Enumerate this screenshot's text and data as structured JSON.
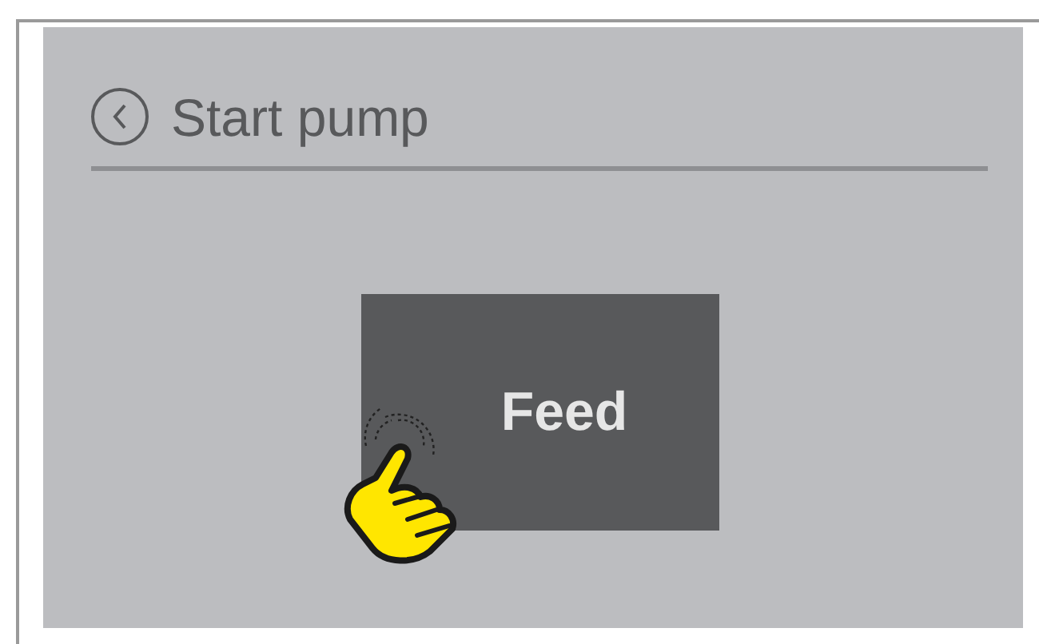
{
  "header": {
    "title": "Start pump"
  },
  "button": {
    "label": "Feed"
  }
}
